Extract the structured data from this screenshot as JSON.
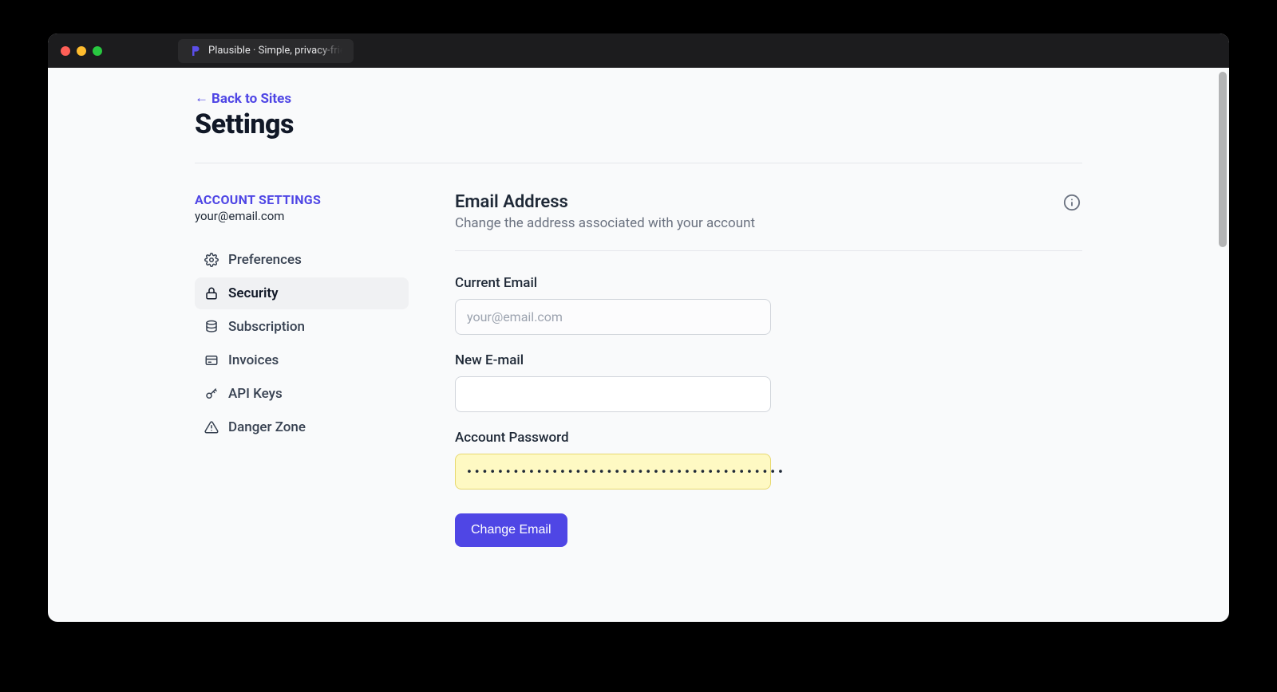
{
  "browser": {
    "tab_title": "Plausible · Simple, privacy-frien"
  },
  "header": {
    "back_link": "Back to Sites",
    "page_title": "Settings"
  },
  "sidebar": {
    "heading": "ACCOUNT SETTINGS",
    "account_email": "your@email.com",
    "items": [
      {
        "label": "Preferences"
      },
      {
        "label": "Security"
      },
      {
        "label": "Subscription"
      },
      {
        "label": "Invoices"
      },
      {
        "label": "API Keys"
      },
      {
        "label": "Danger Zone"
      }
    ],
    "active_index": 1
  },
  "card": {
    "title": "Email Address",
    "subtitle": "Change the address associated with your account",
    "fields": {
      "current_email": {
        "label": "Current Email",
        "value": "your@email.com"
      },
      "new_email": {
        "label": "New E-mail",
        "value": ""
      },
      "account_password": {
        "label": "Account Password",
        "masked_value": "•••••••••••••••••••••••••••••••••••••••••"
      }
    },
    "submit_label": "Change Email"
  },
  "colors": {
    "accent": "#4f46e5"
  }
}
